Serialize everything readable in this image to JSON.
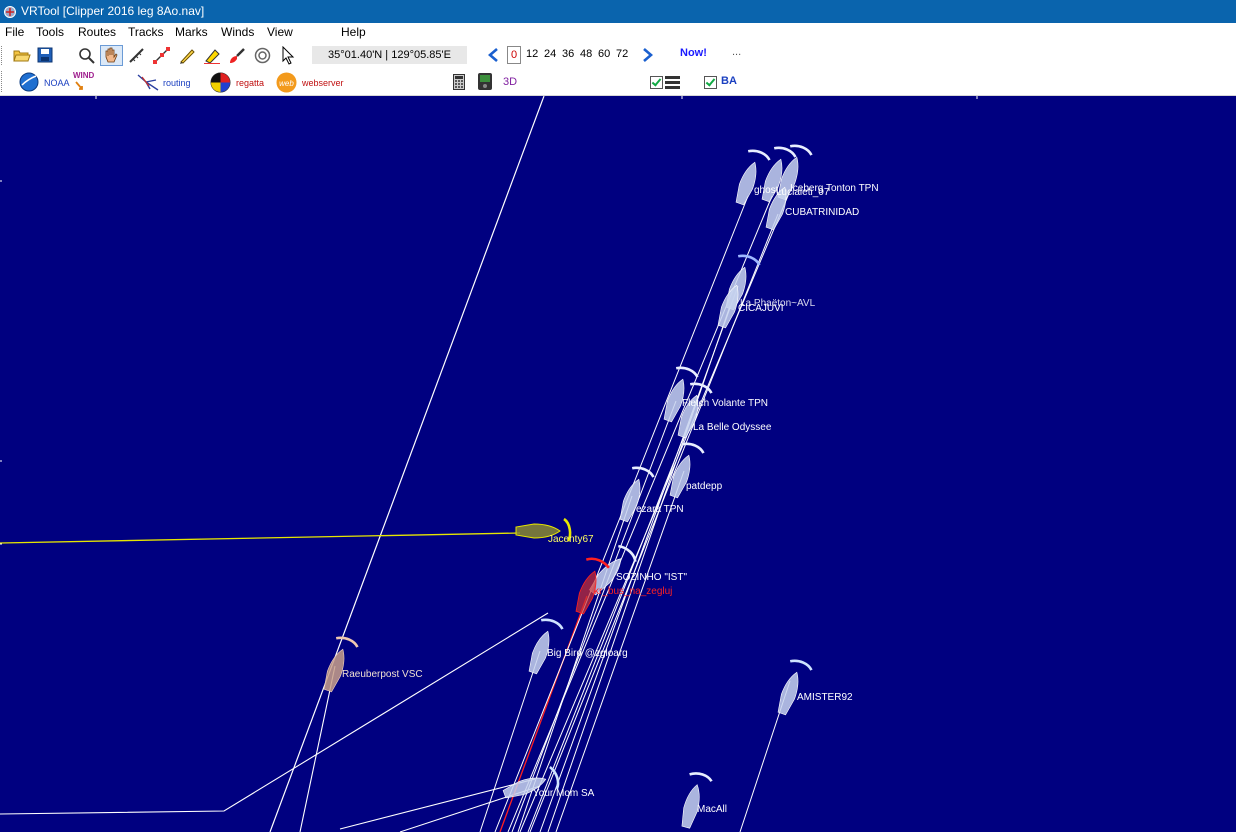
{
  "window": {
    "title": "VRTool [Clipper 2016 leg 8Ao.nav]"
  },
  "menu": [
    "File",
    "Tools",
    "Routes",
    "Tracks",
    "Marks",
    "Winds",
    "View",
    "Help"
  ],
  "toolbar": {
    "coordinates": "35°01.40'N | 129°05.85'E",
    "hours": [
      "0",
      "12",
      "24",
      "36",
      "48",
      "60",
      "72"
    ],
    "now_label": "Now!",
    "more_label": "..."
  },
  "toolbar2": {
    "noaa_label": "NOAA",
    "wind_label": "WIND",
    "routing_label": "routing",
    "regatta_label": "regatta",
    "web_badge": "web",
    "webserver_label": "webserver",
    "view3d_label": "3D",
    "ba_label": "BA"
  },
  "colors": {
    "sea": "#000080",
    "own_boat": "#e6e600",
    "red_boat": "#ff2020",
    "track": "#ffffff"
  },
  "boats": {
    "b1": "ghost",
    "b2": "Lucialeti_07",
    "b3": "Iceberg Tonton TPN",
    "b4": "CUBATRINIDAD",
    "b5": "La Phaëton~AVL",
    "b6": "CICAJUVI",
    "b7": "Fletch Volante TPN",
    "b8": "La Belle Odyssee",
    "b9": "patdepp",
    "b10": "ezara TPN",
    "b11": "Jacenty67",
    "b12": "SOZINHO \"IST\"",
    "b13": "kr_bus_na_zegluj",
    "b14": "Big Bird @zgloarg",
    "b15": "Raeuberpost VSC",
    "b16": "AMISTER92",
    "b17": "Your Mom SA",
    "b18": "MacAll"
  }
}
